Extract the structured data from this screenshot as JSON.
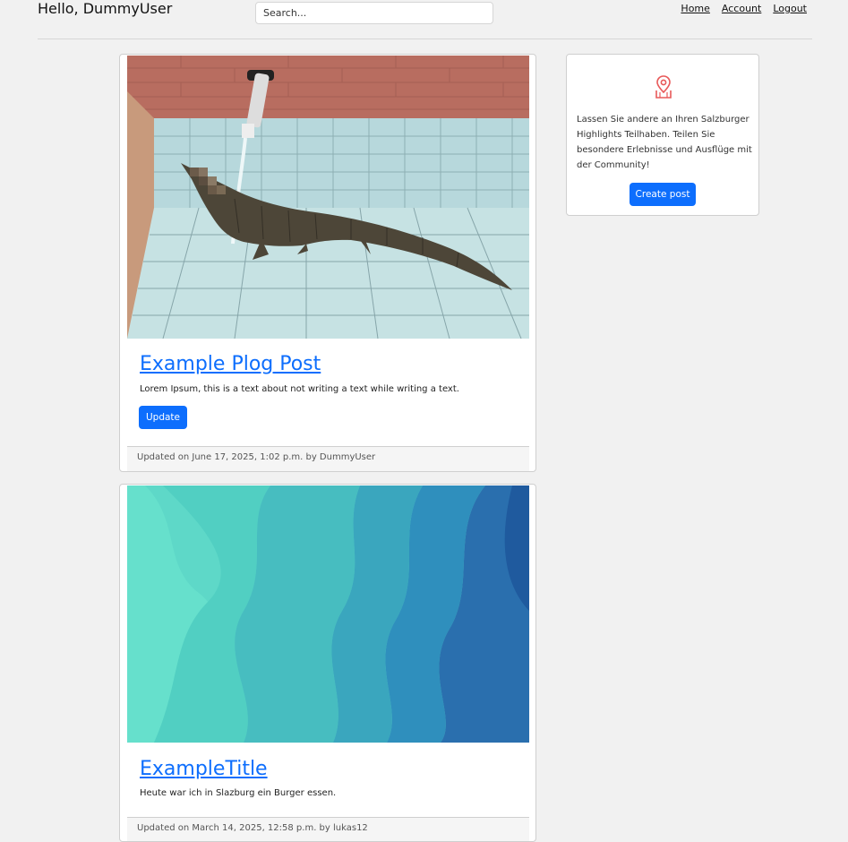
{
  "header": {
    "greeting": "Hello, DummyUser",
    "search_placeholder": "Search...",
    "nav": {
      "home": "Home",
      "account": "Account",
      "logout": "Logout"
    }
  },
  "posts": [
    {
      "title": "Example Plog Post",
      "text": "Lorem Ipsum, this is a text about not writing a text while writing a text.",
      "button_label": "Update",
      "footer": "Updated on June 17, 2025, 1:02 p.m. by DummyUser",
      "image": "crocodile-in-empty-pool"
    },
    {
      "title": "ExampleTitle",
      "text": "Heute war ich in Slazburg ein Burger essen.",
      "footer": "Updated on March 14, 2025, 12:58 p.m. by lukas12",
      "image": "turquoise-wave-paper-art"
    }
  ],
  "sidebar": {
    "icon": "map-pin-icon",
    "text": "Lassen Sie andere an Ihren Salzburger Highlights Teilhaben. Teilen Sie besondere Erlebnisse und Ausflüge mit der Community!",
    "button_label": "Create post"
  },
  "colors": {
    "accent": "#0d6efd",
    "background": "#f1f1f1",
    "icon": "#e85a5a"
  }
}
